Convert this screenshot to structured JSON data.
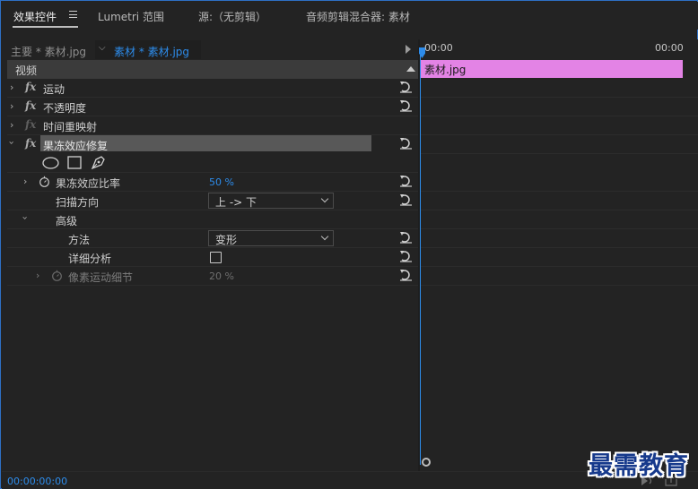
{
  "tabs": {
    "effects": "效果控件",
    "lumetri": "Lumetri 范围",
    "source": "源:（无剪辑）",
    "mixer": "音频剪辑混合器: 素材"
  },
  "clip_selector": {
    "master": "主要 * 素材.jpg",
    "sequence": "素材 * 素材.jpg"
  },
  "section": {
    "video": "视频"
  },
  "effects": {
    "motion": "运动",
    "opacity": "不透明度",
    "time_remap": "时间重映射",
    "freeze": "果冻效应修复"
  },
  "params": {
    "rate_label": "果冻效应比率",
    "rate_value": "50 %",
    "scan_label": "扫描方向",
    "scan_value": "上 -> 下",
    "advanced_label": "高级",
    "method_label": "方法",
    "method_value": "变形",
    "detailed_label": "详细分析",
    "detailed_checked": false,
    "pixel_label": "像素运动细节",
    "pixel_value": "20 %"
  },
  "timeline": {
    "start": "00:00",
    "end": "00:00",
    "clip_name": "素材.jpg",
    "clip_color": "#e383e5",
    "playhead_color": "#2d8ceb"
  },
  "footer": {
    "timecode": "00:00:00:00"
  },
  "watermark": "最需教育",
  "colors": {
    "accent": "#2d8ceb",
    "panel_border": "#2e6fc4"
  }
}
